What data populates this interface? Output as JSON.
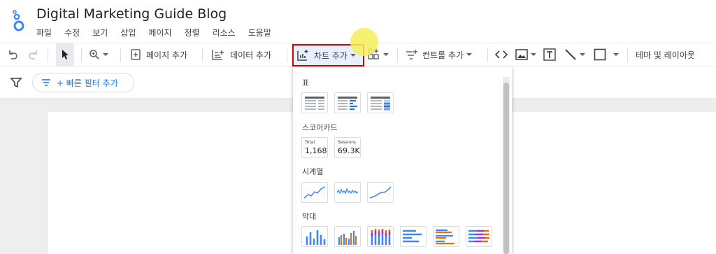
{
  "header": {
    "title": "Digital Marketing Guide Blog",
    "menu": [
      "파일",
      "수정",
      "보기",
      "삽입",
      "페이지",
      "정렬",
      "리소스",
      "도움말"
    ]
  },
  "toolbar": {
    "add_page": "페이지 추가",
    "add_data": "데이터 추가",
    "add_chart": "차트 추가",
    "add_control": "컨트롤 추가",
    "theme_layout": "테마 및 레이아웃"
  },
  "filter_bar": {
    "quick_filter": "+ 빠른 필터 추가"
  },
  "chart_menu": {
    "sections": {
      "table": "표",
      "scorecard": "스코어카드",
      "timeseries": "시계열",
      "bar": "막대"
    },
    "scorecards": [
      {
        "label": "Total",
        "value": "1,168"
      },
      {
        "label": "Sessions",
        "value": "69.3K"
      }
    ]
  },
  "colors": {
    "accent_blue": "#1a73e8",
    "highlight_red": "#d50000",
    "bar_orange": "#e8710a",
    "bar_purple": "#9334e6"
  }
}
